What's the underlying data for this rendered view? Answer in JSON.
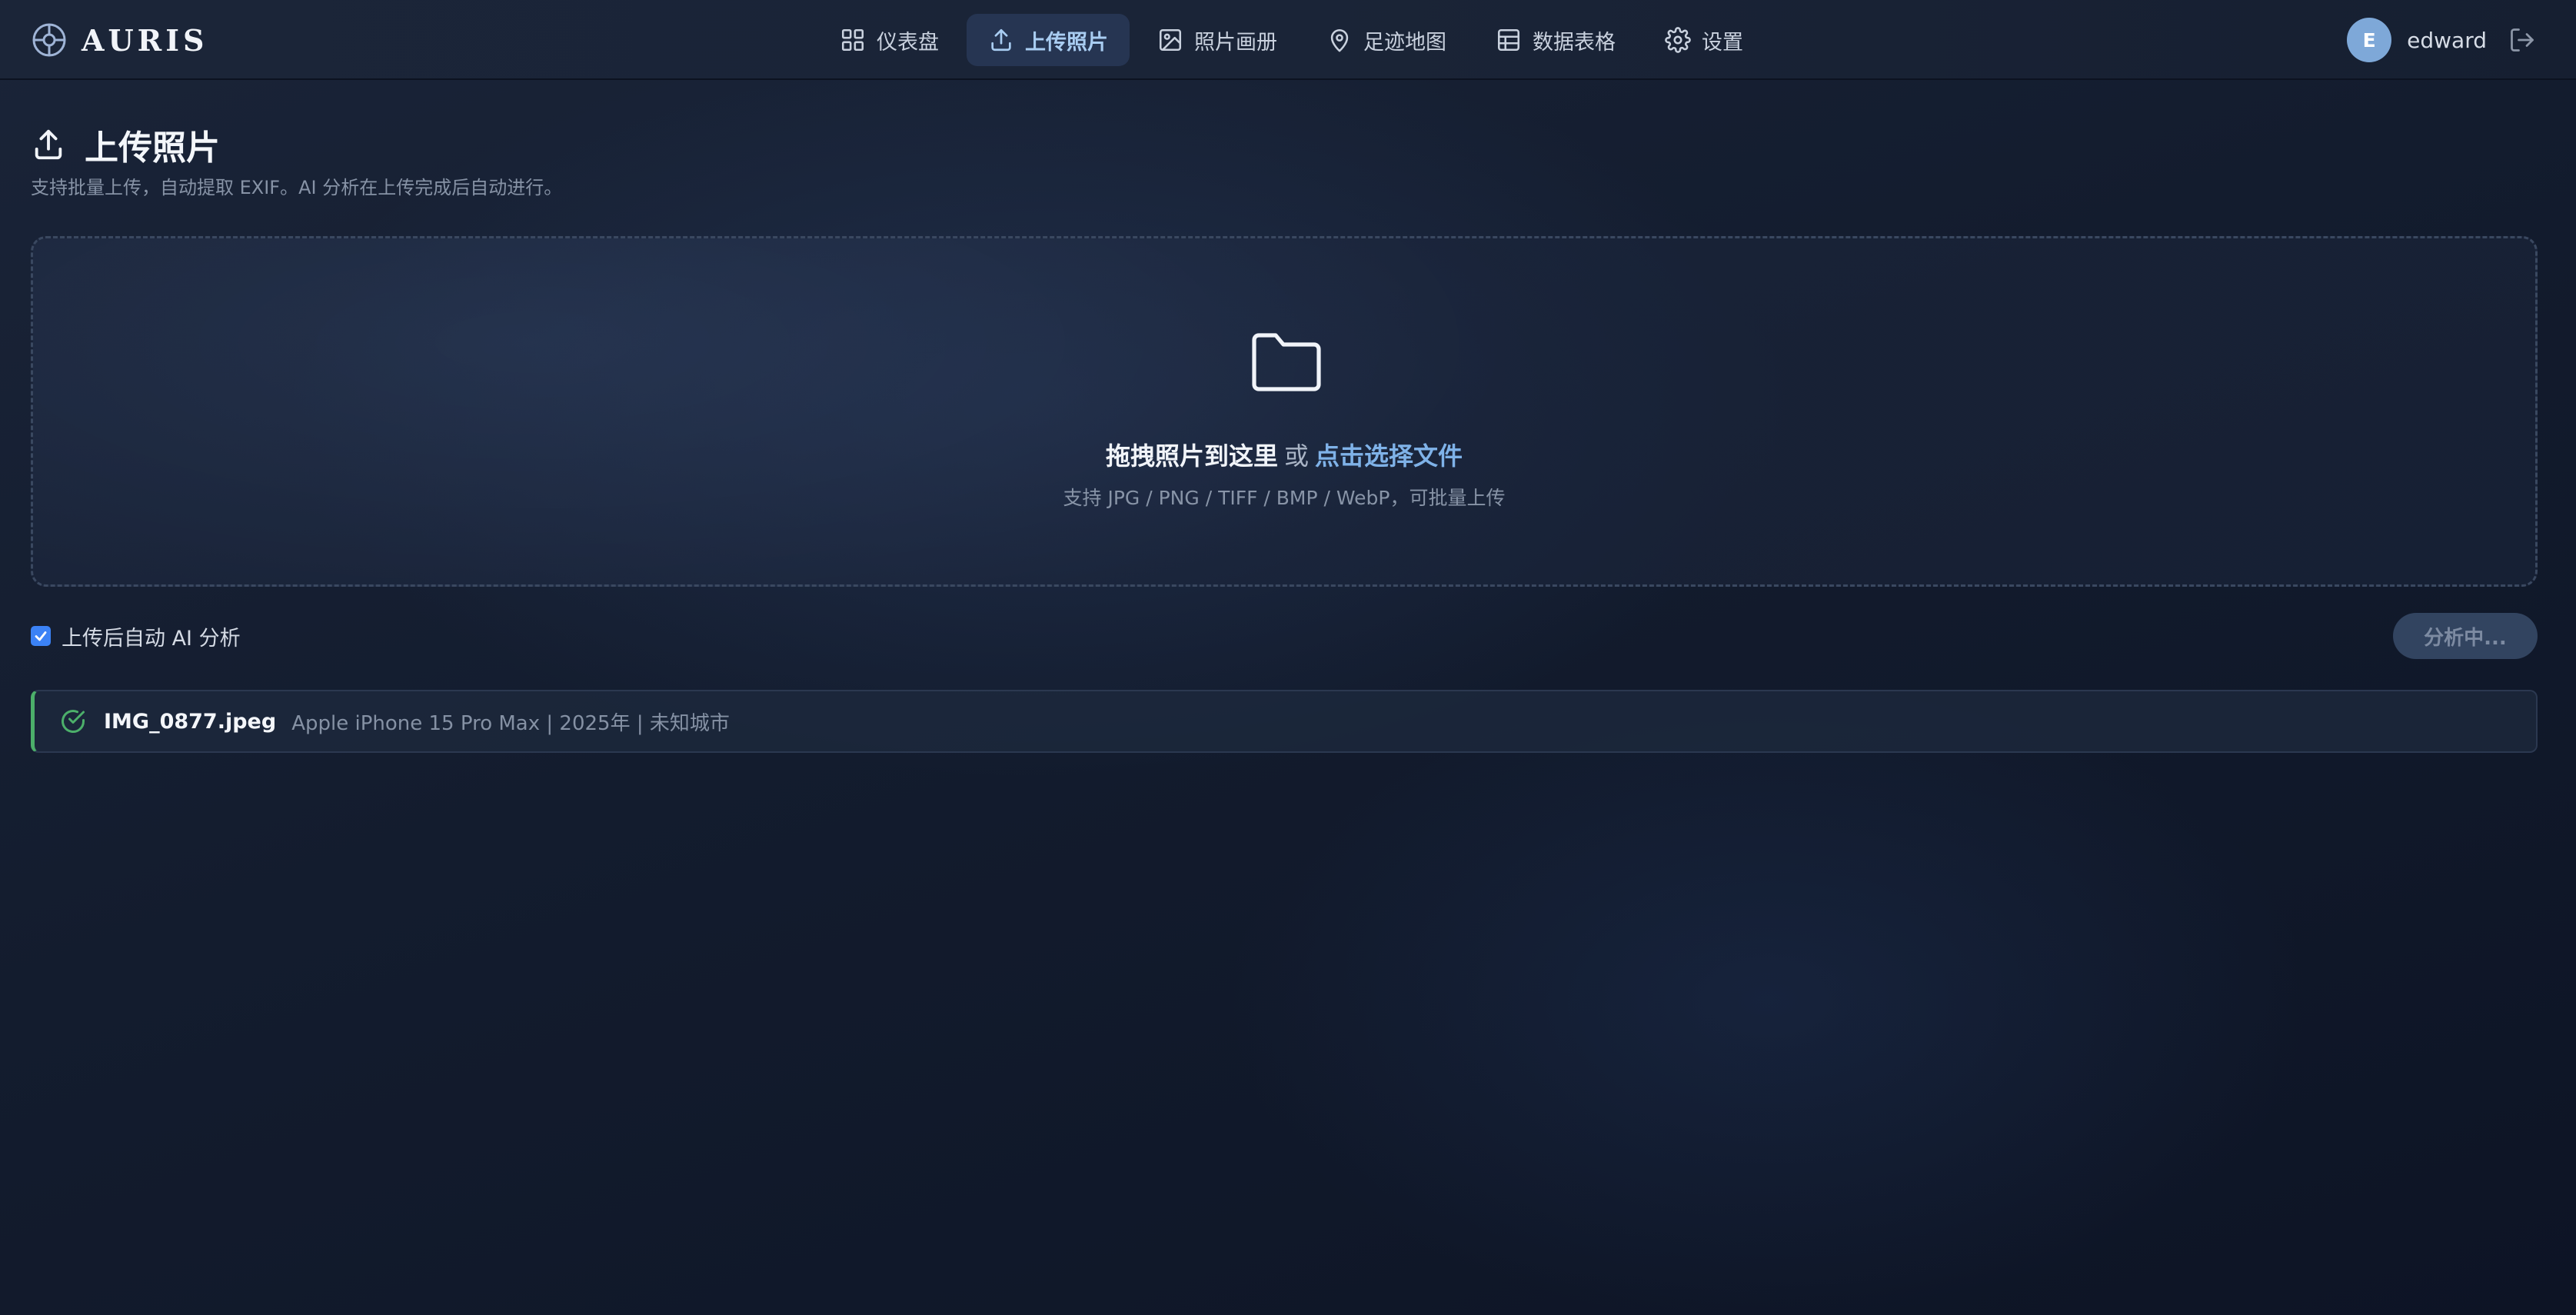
{
  "brand": {
    "name": "AURIS",
    "icon": "aperture-icon"
  },
  "nav": {
    "items": [
      {
        "label": "仪表盘",
        "icon": "grid-icon"
      },
      {
        "label": "上传照片",
        "icon": "upload-icon",
        "active": true
      },
      {
        "label": "照片画册",
        "icon": "image-icon"
      },
      {
        "label": "足迹地图",
        "icon": "map-pin-icon"
      },
      {
        "label": "数据表格",
        "icon": "table-icon"
      },
      {
        "label": "设置",
        "icon": "gear-icon"
      }
    ]
  },
  "user": {
    "initial": "E",
    "name": "edward",
    "logout_icon": "logout-icon"
  },
  "page": {
    "title": "上传照片",
    "subtitle": "支持批量上传，自动提取 EXIF。AI 分析在上传完成后自动进行。"
  },
  "dropzone": {
    "title_strong": "拖拽照片到这里",
    "title_or": "或",
    "title_link": "点击选择文件",
    "hint": "支持 JPG / PNG / TIFF / BMP / WebP，可批量上传"
  },
  "options": {
    "auto_ai_label": "上传后自动 AI 分析",
    "auto_ai_checked": true,
    "analyze_button_label": "分析中..."
  },
  "files": [
    {
      "name": "IMG_0877.jpeg",
      "meta": "Apple iPhone 15 Pro Max | 2025年 | 未知城市",
      "status": "success"
    }
  ],
  "colors": {
    "accent": "#7fb2e8",
    "active_nav_bg": "#263552",
    "success": "#4caf6a",
    "avatar": "#7ea8d8",
    "checkbox": "#3b82f6"
  }
}
